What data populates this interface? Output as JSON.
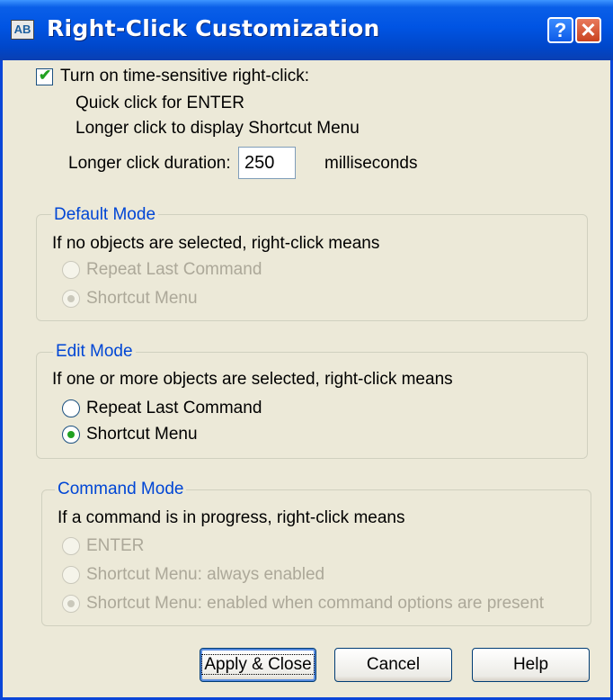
{
  "window": {
    "title": "Right-Click Customization",
    "help_glyph": "?",
    "close_glyph": "✕",
    "app_icon_label": "AB"
  },
  "time_sensitive": {
    "label": "Turn on time-sensitive right-click:",
    "checked": true,
    "line1": "Quick click for ENTER",
    "line2": "Longer click to display Shortcut Menu",
    "duration_label": "Longer click duration:",
    "duration_value": "250",
    "duration_unit": "milliseconds"
  },
  "default_mode": {
    "legend": "Default Mode",
    "prompt": "If no objects are selected, right-click means",
    "options": [
      "Repeat Last Command",
      "Shortcut Menu"
    ],
    "selected": "Shortcut Menu",
    "enabled": false
  },
  "edit_mode": {
    "legend": "Edit Mode",
    "prompt": "If one or more objects are selected, right-click means",
    "options": [
      "Repeat Last Command",
      "Shortcut Menu"
    ],
    "selected": "Shortcut Menu",
    "enabled": true
  },
  "command_mode": {
    "legend": "Command Mode",
    "prompt": "If a command is in progress, right-click means",
    "options": [
      "ENTER",
      "Shortcut Menu: always enabled",
      "Shortcut Menu: enabled when command options are present"
    ],
    "selected": "Shortcut Menu: enabled when command options are present",
    "enabled": false
  },
  "buttons": {
    "apply": "Apply & Close",
    "cancel": "Cancel",
    "help": "Help"
  },
  "colors": {
    "titlebar": "#0054e3",
    "dialog_bg": "#ece9d8",
    "group_legend": "#0046d5",
    "disabled_text": "#aca899"
  }
}
